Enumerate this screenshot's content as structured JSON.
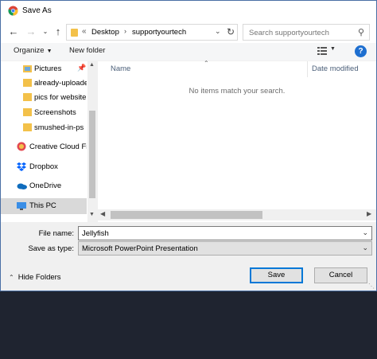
{
  "window": {
    "title": "Save As"
  },
  "nav": {
    "breadcrumb": [
      "Desktop",
      "supportyourtech"
    ],
    "overflow": "«"
  },
  "search": {
    "placeholder": "Search supportyourtech"
  },
  "toolbar": {
    "organize_label": "Organize",
    "new_folder_label": "New folder",
    "help_label": "?"
  },
  "sidebar": {
    "items": [
      {
        "label": "Pictures",
        "icon": "pictures-icon",
        "pinned": true
      },
      {
        "label": "already-uploade",
        "icon": "folder-icon"
      },
      {
        "label": "pics for website",
        "icon": "folder-icon"
      },
      {
        "label": "Screenshots",
        "icon": "folder-icon"
      },
      {
        "label": "smushed-in-ps",
        "icon": "folder-icon"
      },
      {
        "label": "Creative Cloud Fil",
        "icon": "creative-cloud-icon"
      },
      {
        "label": "Dropbox",
        "icon": "dropbox-icon"
      },
      {
        "label": "OneDrive",
        "icon": "onedrive-icon"
      },
      {
        "label": "This PC",
        "icon": "this-pc-icon",
        "selected": true
      }
    ]
  },
  "content": {
    "columns": [
      "Name",
      "Date modified"
    ],
    "empty_message": "No items match your search."
  },
  "form": {
    "file_name_label": "File name:",
    "file_name_value": "Jellyfish",
    "save_type_label": "Save as type:",
    "save_type_value": "Microsoft PowerPoint Presentation"
  },
  "footer": {
    "hide_folders_label": "Hide Folders",
    "save_label": "Save",
    "cancel_label": "Cancel"
  },
  "colors": {
    "accent": "#0078d7",
    "folder": "#f3c14a",
    "help": "#1e6fd0",
    "taskbar": "#1f2430"
  }
}
